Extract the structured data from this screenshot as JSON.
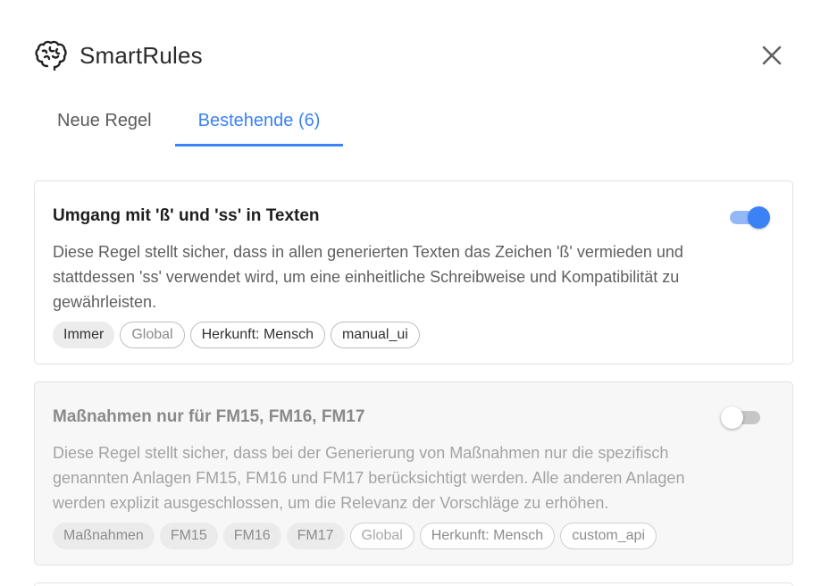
{
  "app": {
    "title": "SmartRules",
    "logo_icon": "brain-icon",
    "close_icon": "close-icon"
  },
  "tabs": [
    {
      "label": "Neue Regel",
      "active": false
    },
    {
      "label": "Bestehende (6)",
      "active": true
    }
  ],
  "colors": {
    "accent": "#3b82f6",
    "toggle_track_on": "#93b8f6"
  },
  "rules": [
    {
      "title": "Umgang mit 'ß' und 'ss' in Texten",
      "description": "Diese Regel stellt sicher, dass in allen generierten Texten das Zeichen 'ß' vermieden und stattdessen 'ss' verwendet wird, um eine einheitliche Schreibweise und Kompatibilität zu gewährleisten.",
      "enabled": true,
      "tags": [
        {
          "label": "Immer",
          "style": "filled"
        },
        {
          "label": "Global",
          "style": "muted"
        },
        {
          "label": "Herkunft: Mensch",
          "style": "outlined"
        },
        {
          "label": "manual_ui",
          "style": "outlined"
        }
      ]
    },
    {
      "title": "Maßnahmen nur für FM15, FM16, FM17",
      "description": "Diese Regel stellt sicher, dass bei der Generierung von Maßnahmen nur die spezifisch genannten Anlagen FM15, FM16 und FM17 berücksichtigt werden. Alle anderen Anlagen werden explizit ausgeschlossen, um die Relevanz der Vorschläge zu erhöhen.",
      "enabled": false,
      "tags": [
        {
          "label": "Maßnahmen",
          "style": "filled"
        },
        {
          "label": "FM15",
          "style": "filled"
        },
        {
          "label": "FM16",
          "style": "filled"
        },
        {
          "label": "FM17",
          "style": "filled"
        },
        {
          "label": "Global",
          "style": "muted"
        },
        {
          "label": "Herkunft: Mensch",
          "style": "outlined"
        },
        {
          "label": "custom_api",
          "style": "outlined"
        }
      ]
    }
  ]
}
